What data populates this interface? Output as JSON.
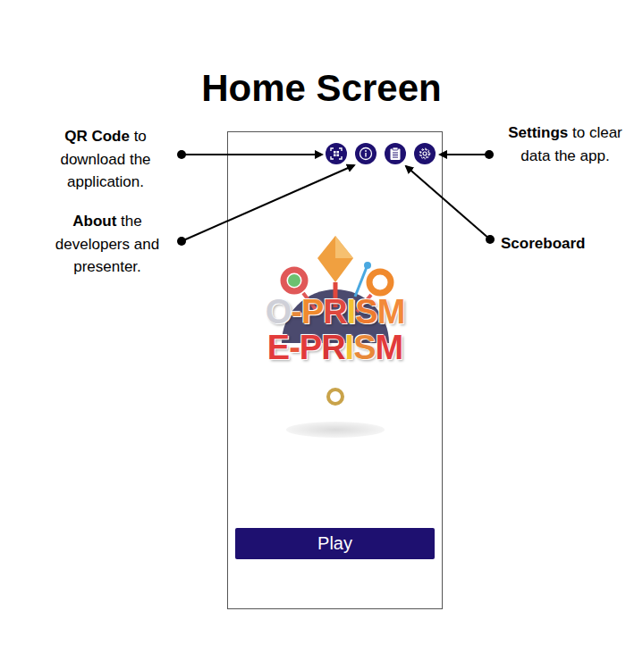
{
  "title": "Home Screen",
  "annotations": [
    {
      "bold": "QR Code",
      "text": " to download the application."
    },
    {
      "bold": "About",
      "text": " the developers and presenter."
    },
    {
      "bold": "Settings",
      "text": " to clear data the app."
    },
    {
      "bold": "Scoreboard"
    }
  ],
  "phone": {
    "toolbar": [
      {
        "kind": "qr"
      },
      {
        "kind": "info"
      },
      {
        "kind": "clipboard"
      },
      {
        "kind": "gear"
      }
    ],
    "logo": {
      "lines": [
        "O-PRISM",
        "E-PRISM"
      ]
    },
    "play_button": {
      "label": "Play"
    }
  }
}
